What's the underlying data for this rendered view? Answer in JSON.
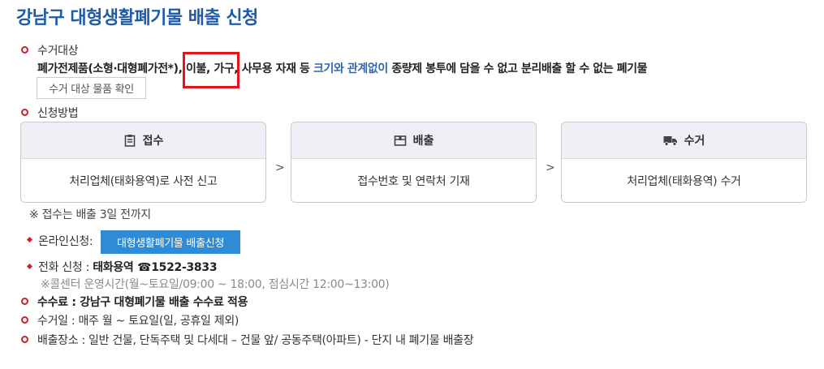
{
  "page_title": "강남구 대형생활폐기물 배출 신청",
  "target": {
    "heading": "수거대상",
    "line_part1": "폐가전제품(소형·대형폐가전*), 이불, 가구, 사무용 자재 등 ",
    "line_highlight": "크기와 관계없이",
    "line_part2": " 종량제 봉투에 담을 수 없고 분리배출 할 수 없는 폐기물",
    "check_button": "수거 대상 물품 확인"
  },
  "method": {
    "heading": "신청방법",
    "steps": [
      {
        "icon": "clipboard-icon",
        "title": "접수",
        "desc": "처리업체(태화용역)로 사전 신고"
      },
      {
        "icon": "box-icon",
        "title": "배출",
        "desc": "접수번호 및 연락처 기재"
      },
      {
        "icon": "truck-icon",
        "title": "수거",
        "desc": "처리업체(태화용역) 수거"
      }
    ],
    "arrow": ">",
    "note": "※ 접수는 배출 3일 전까지"
  },
  "online": {
    "label": "온라인신청:",
    "button": "대형생활폐기물 배출신청"
  },
  "phone": {
    "label": "전화 신청 : ",
    "value": "태화용역 ☎1522-3833",
    "hours": "※콜센터 운영시간(월~토요일/09:00 ~ 18:00, 점심시간 12:00~13:00)"
  },
  "fee": {
    "label": "수수료 : ",
    "value": "강남구 대형폐기물 배출 수수료 적용"
  },
  "collection_day": "수거일 : 매주 월 ~ 토요일(일, 공휴일 제외)",
  "location": "배출장소 : 일반 건물, 단독주택 및 다세대 – 건물 앞/ 공동주택(아파트) - 단지 내 폐기물 배출장",
  "colors": {
    "title": "#1e5aa8",
    "bullet": "#c8202f",
    "highlight": "#2f67b1",
    "button": "#2f8bd6",
    "annotation_box": "#e3141c"
  }
}
